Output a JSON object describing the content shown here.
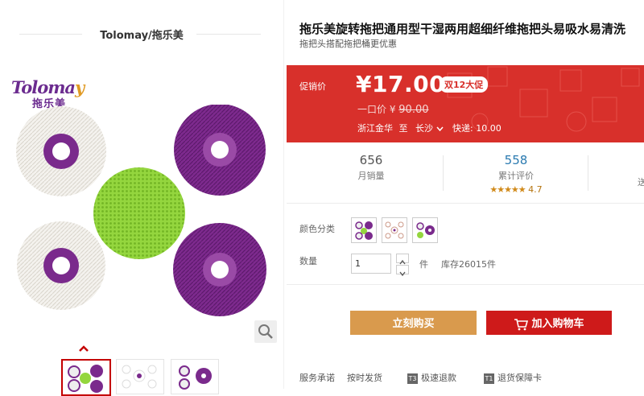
{
  "brand": {
    "store_title": "Tolomay/拖乐美",
    "logo_en_main": "Toloma",
    "logo_en_accent": "y",
    "logo_cn": "拖乐美"
  },
  "product": {
    "title": "拖乐美旋转拖把通用型干湿两用超细纤维拖把头易吸水易清洗",
    "subtitle": "拖把头搭配拖把桶更优惠"
  },
  "promo": {
    "label": "促销价",
    "price": "¥17.00",
    "badge": "双12大促",
    "orig_label": "一口价 ¥",
    "orig_price": "90.00",
    "ship_from": "浙江金华",
    "ship_to_word": "至",
    "ship_to": "长沙",
    "ship_fee": "快递: 10.00"
  },
  "stats": {
    "monthly_sales": "656",
    "monthly_sales_label": "月销量",
    "reviews": "558",
    "reviews_label": "累计评价",
    "rating": "4.7",
    "third_label": "送"
  },
  "options": {
    "color_label": "颜色分类",
    "qty_label": "数量",
    "qty_value": "1",
    "unit": "件",
    "stock": "库存26015件"
  },
  "buttons": {
    "buy_now": "立刻购买",
    "add_to_cart": "加入购物车"
  },
  "service": {
    "label": "服务承诺",
    "item1": "按时发货",
    "item2": "极速退款",
    "item3": "退货保障卡",
    "icon2": "T3",
    "icon3": "T1"
  },
  "colors": {
    "promo_red": "#d8302b",
    "buy_orange": "#d99a4d",
    "cart_red": "#ce1a1a",
    "purple": "#7a2a8c",
    "lime": "#8fd43a"
  }
}
